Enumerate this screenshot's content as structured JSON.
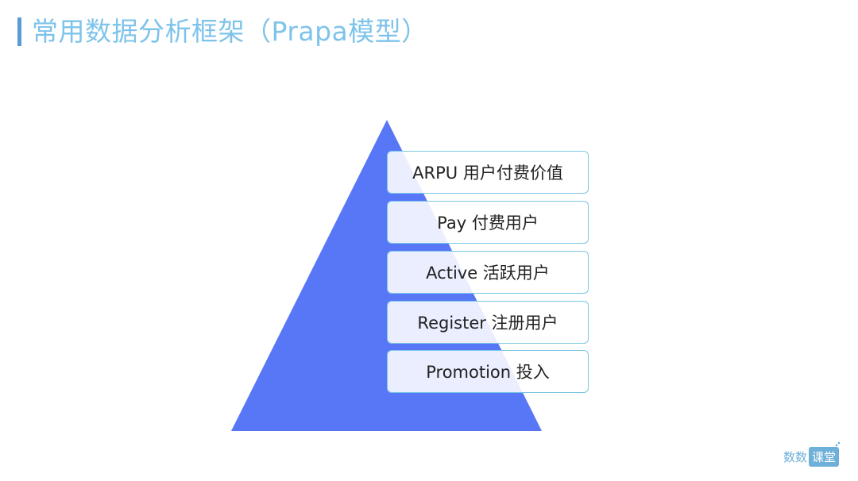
{
  "header": {
    "title": "常用数据分析框架（Prapa模型）"
  },
  "diagram": {
    "triangle_color": "#5877f7",
    "layers": [
      "ARPU 用户付费价值",
      "Pay 付费用户",
      "Active 活跃用户",
      "Register 注册用户",
      "Promotion 投入"
    ]
  },
  "brand": {
    "part1": "数数",
    "part2": "课堂"
  }
}
